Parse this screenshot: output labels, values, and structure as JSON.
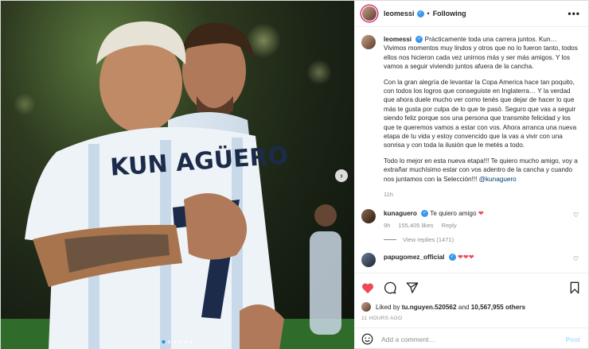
{
  "post": {
    "author": "leomessi",
    "follow_status": "Following",
    "more_icon": "more-horizontal-icon",
    "jersey_text": "KUN AGÜERO",
    "caption": {
      "p1": "Prácticamente toda una carrera juntos. Kun… Vivimos momentos muy lindos y otros que no lo fueron tanto, todos ellos nos hicieron cada vez unirnos más y ser más amigos. Y los vamos a seguir viviendo juntos afuera de la cancha.",
      "p2": "Con la gran alegría de levantar la Copa America hace tan poquito, con todos los logros que conseguiste en Inglaterra… Y la verdad que ahora duele mucho ver como tenés que dejar de hacer lo que más te gusta por culpa de lo que te pasó. Seguro que vas a seguir siendo feliz porque sos una persona que transmite felicidad y los que te queremos vamos a estar con vos. Ahora arranca una nueva etapa de tu vida y estoy convencido que la vas a vivir con una sonrisa y con toda la ilusión que le metés a todo.",
      "p3": "Todo lo mejor en esta nueva etapa!!! Te quiero mucho amigo, voy a extrañar muchísimo estar con vos adentro de la cancha y cuando nos juntamos con la Selección!!! ",
      "mention": "@kunaguero",
      "time": "11h"
    },
    "comments": [
      {
        "user": "kunaguero",
        "text": "Te quiero amigo",
        "emoji": "❤",
        "time": "9h",
        "likes": "155,405 likes",
        "reply": "Reply",
        "view_replies": "View replies (1471)"
      },
      {
        "user": "papugomez_official",
        "emoji": "❤❤❤"
      }
    ],
    "likes": {
      "prefix": "Liked by ",
      "user": "tu.nguyen.520562",
      "middle": " and ",
      "others": "10,567,955 others"
    },
    "time_ago": "11 HOURS AGO",
    "add_comment": {
      "placeholder": "Add a comment…",
      "post_label": "Post"
    },
    "carousel": {
      "dot_count": 6,
      "active_index": 0
    },
    "colors": {
      "verified": "#3897f0",
      "liked_heart": "#ed4956",
      "post_button_disabled": "#b2dffc",
      "mention": "#00376b"
    }
  }
}
